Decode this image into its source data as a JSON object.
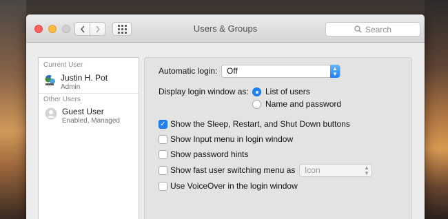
{
  "window": {
    "title": "Users & Groups",
    "search_placeholder": "Search",
    "nav_back_icon": "chevron-left-icon",
    "nav_forward_icon": "chevron-right-icon"
  },
  "sidebar": {
    "current_header": "Current User",
    "other_header": "Other Users",
    "users": [
      {
        "name": "Justin H. Pot",
        "role": "Admin"
      },
      {
        "name": "Guest User",
        "role": "Enabled, Managed"
      }
    ]
  },
  "login_options": {
    "automatic_login_label": "Automatic login:",
    "automatic_login_value": "Off",
    "display_label": "Display login window as:",
    "display_options": [
      {
        "label": "List of users",
        "selected": true
      },
      {
        "label": "Name and password",
        "selected": false
      }
    ],
    "checkboxes": [
      {
        "label": "Show the Sleep, Restart, and Shut Down buttons",
        "checked": true
      },
      {
        "label": "Show Input menu in login window",
        "checked": false
      },
      {
        "label": "Show password hints",
        "checked": false
      },
      {
        "label": "Show fast user switching menu as",
        "checked": false
      },
      {
        "label": "Use VoiceOver in the login window",
        "checked": false
      }
    ],
    "fast_switch_value": "Icon"
  },
  "colors": {
    "accent": "#1e83f7",
    "close": "#fc605c",
    "minimize": "#fdbc40"
  }
}
